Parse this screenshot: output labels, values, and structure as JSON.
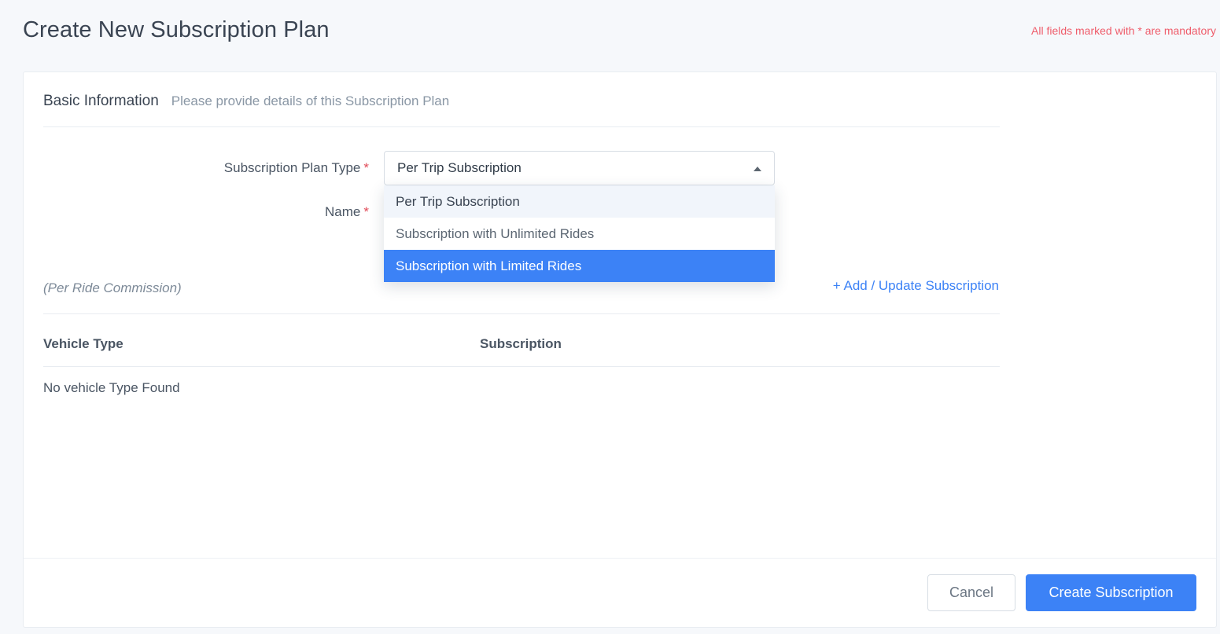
{
  "header": {
    "title": "Create New Subscription Plan",
    "mandatory_note": "All fields marked with * are mandatory"
  },
  "basic_info": {
    "title": "Basic Information",
    "subtitle": "Please provide details of this Subscription Plan"
  },
  "form": {
    "plan_type_label": "Subscription Plan Type",
    "name_label": "Name",
    "required_mark": "*",
    "plan_type_value": "Per Trip Subscription",
    "plan_type_options": [
      "Per Trip Subscription",
      "Subscription with Unlimited Rides",
      "Subscription with Limited Rides"
    ]
  },
  "vehicle_section": {
    "commission_note": "(Per Ride Commission)",
    "add_update_link": "+ Add / Update Subscription",
    "columns": [
      "Vehicle Type",
      "Subscription"
    ],
    "empty_text": "No vehicle Type Found"
  },
  "actions": {
    "cancel_label": "Cancel",
    "create_label": "Create Subscription"
  },
  "colors": {
    "accent": "#3c82f6",
    "required": "#e14b58",
    "mandatory_note": "#ef5d6b"
  }
}
